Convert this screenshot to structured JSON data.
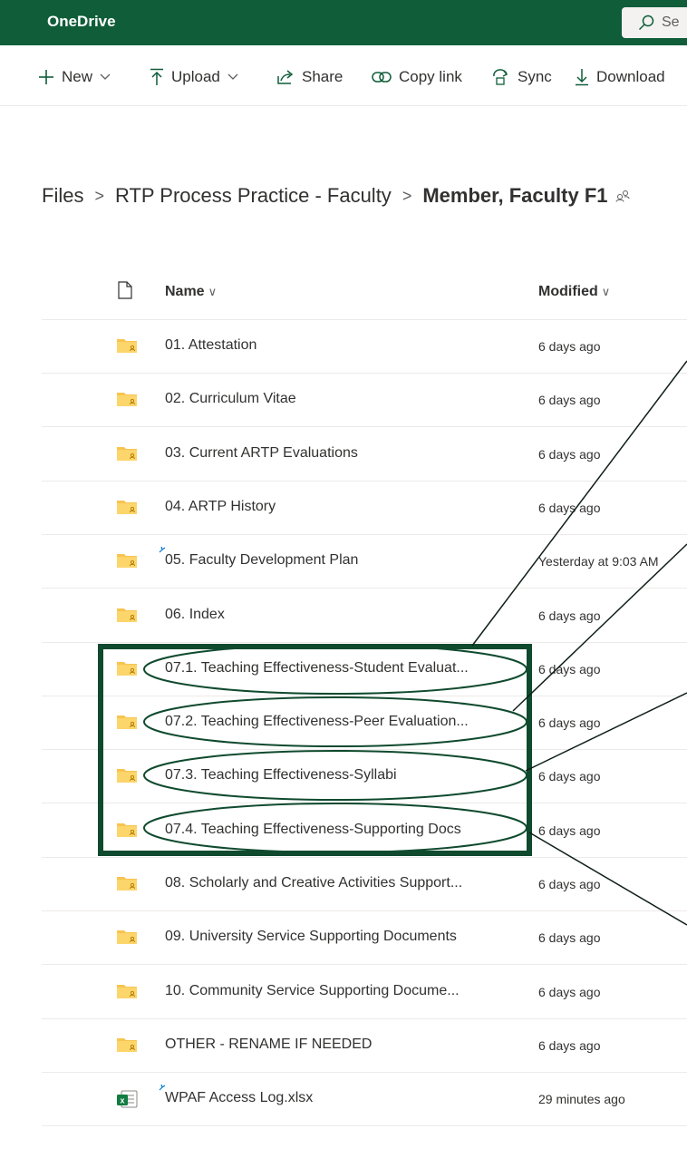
{
  "app": {
    "brand": "OneDrive",
    "search_placeholder": "Se"
  },
  "toolbar": {
    "new_label": "New",
    "upload_label": "Upload",
    "share_label": "Share",
    "copy_link_label": "Copy link",
    "sync_label": "Sync",
    "download_label": "Download"
  },
  "breadcrumb": {
    "root": "Files",
    "middle": "RTP Process Practice - Faculty",
    "current": "Member, Faculty F1"
  },
  "columns": {
    "name": "Name",
    "modified": "Modified"
  },
  "files": [
    {
      "name": "01. Attestation",
      "modified": "6 days ago",
      "type": "shared-folder"
    },
    {
      "name": "02. Curriculum Vitae",
      "modified": "6 days ago",
      "type": "shared-folder"
    },
    {
      "name": "03. Current ARTP Evaluations",
      "modified": "6 days ago",
      "type": "shared-folder"
    },
    {
      "name": "04. ARTP History",
      "modified": "6 days ago",
      "type": "shared-folder"
    },
    {
      "name": "05. Faculty Development Plan",
      "modified": "Yesterday at 9:03 AM",
      "type": "shared-folder",
      "new": true
    },
    {
      "name": "06. Index",
      "modified": "6 days ago",
      "type": "shared-folder"
    },
    {
      "name": "07.1. Teaching Effectiveness-Student Evaluat...",
      "modified": "6 days ago",
      "type": "shared-folder"
    },
    {
      "name": "07.2. Teaching Effectiveness-Peer Evaluation...",
      "modified": "6 days ago",
      "type": "shared-folder"
    },
    {
      "name": "07.3. Teaching Effectiveness-Syllabi",
      "modified": "6 days ago",
      "type": "shared-folder"
    },
    {
      "name": "07.4. Teaching Effectiveness-Supporting Docs",
      "modified": "6 days ago",
      "type": "shared-folder"
    },
    {
      "name": "08. Scholarly and Creative Activities Support...",
      "modified": "6 days ago",
      "type": "shared-folder"
    },
    {
      "name": "09. University Service Supporting Documents",
      "modified": "6 days ago",
      "type": "shared-folder"
    },
    {
      "name": "10. Community Service Supporting Docume...",
      "modified": "6 days ago",
      "type": "shared-folder"
    },
    {
      "name": "OTHER - RENAME IF NEEDED",
      "modified": "6 days ago",
      "type": "shared-folder"
    },
    {
      "name": "WPAF Access Log.xlsx",
      "modified": "29 minutes ago",
      "type": "excel-file",
      "new": true
    }
  ],
  "colors": {
    "brand_bar": "#0f5d39",
    "folder": "#f8c44f",
    "annotation": "#0f4a2e",
    "excel": "#107c41"
  }
}
